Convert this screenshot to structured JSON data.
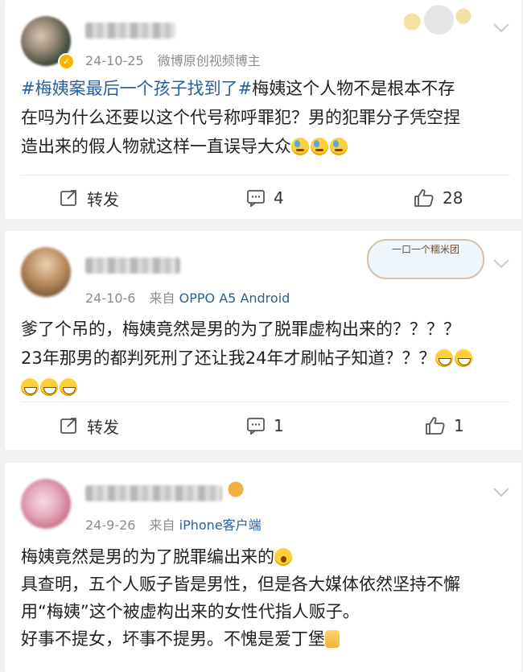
{
  "posts": [
    {
      "date": "24-10-25",
      "source_label": "微博原创视频博主",
      "source_link": "",
      "body_lines": [
        {
          "tags": [
            "#梅姨案最后一个孩子找到了#"
          ],
          "text": "梅姨这个人物不是根本不存"
        },
        {
          "text": "在吗为什么还要以这个代号称呼罪犯？男的犯罪分子凭空捏"
        },
        {
          "text": "造出来的假人物就这样一直误导大众"
        }
      ],
      "emojis": [
        "sweat-emoji",
        "sweat-emoji",
        "sweat-emoji"
      ],
      "actions": {
        "repost": "转发",
        "comments": "4",
        "likes": "28"
      }
    },
    {
      "date": "24-10-6",
      "source_label": "来自",
      "source_link": "OPPO A5 Android",
      "body_lines": [
        {
          "text": "爹了个吊的，梅姨竟然是男的为了脱罪虚构出来的？？？？"
        },
        {
          "text": "23年那男的都判死刑了还让我24年才刷帖子知道？？？"
        }
      ],
      "emojis": [
        "grin-sweat-emoji",
        "grin-sweat-emoji",
        "grin-sweat-emoji",
        "grin-sweat-emoji",
        "grin-sweat-emoji"
      ],
      "badge_text": "一口一个糯米团",
      "actions": {
        "repost": "转发",
        "comments": "1",
        "likes": "1"
      }
    },
    {
      "date": "24-9-26",
      "source_label": "来自",
      "source_link": "iPhone客户端",
      "body_lines": [
        {
          "text": "梅姨竟然是男的为了脱罪编出来的"
        },
        {
          "text": "具查明，五个人贩子皆是男性，但是各大媒体依然坚持不懈"
        },
        {
          "text": "用“梅姨”这个被虚构出来的女性代指人贩子。"
        },
        {
          "text": "好事不提女，坏事不提男。不愧是爱丁堡"
        }
      ],
      "emojis": [
        "shock-emoji",
        "thumbs-up-emoji"
      ]
    }
  ],
  "colors": {
    "link": "#2a5f9e",
    "meta": "#8c8c8c",
    "verified": "#f5b400"
  }
}
